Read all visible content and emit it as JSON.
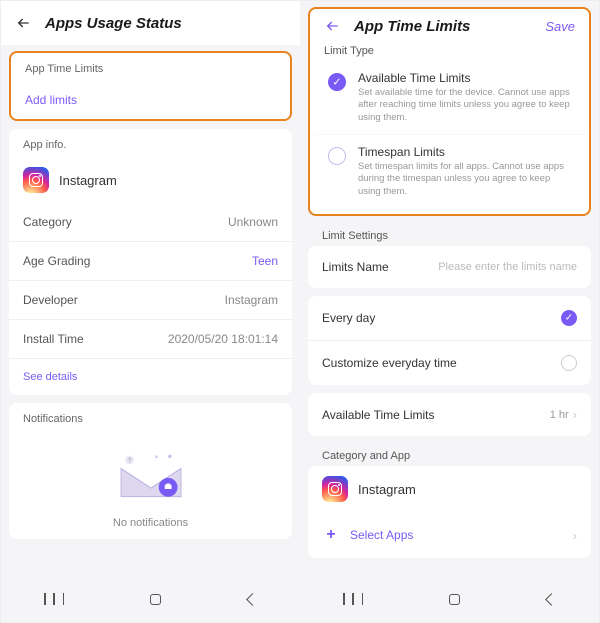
{
  "left": {
    "header": {
      "title": "Apps Usage Status"
    },
    "timeLimitsCard": {
      "heading": "App Time Limits",
      "addLink": "Add limits"
    },
    "appInfo": {
      "heading": "App info.",
      "appName": "Instagram",
      "rows": {
        "categoryLabel": "Category",
        "categoryValue": "Unknown",
        "ageLabel": "Age Grading",
        "ageValue": "Teen",
        "devLabel": "Developer",
        "devValue": "Instagram",
        "installLabel": "Install Time",
        "installValue": "2020/05/20 18:01:14"
      },
      "seeDetails": "See details"
    },
    "notifications": {
      "heading": "Notifications",
      "empty": "No notifications"
    }
  },
  "right": {
    "header": {
      "title": "App Time Limits",
      "save": "Save"
    },
    "limitTypeHeading": "Limit Type",
    "options": {
      "availTitle": "Available Time Limits",
      "availDesc": "Set available time for the device. Cannot use apps after reaching time limits unless you agree to keep using them.",
      "spanTitle": "Timespan Limits",
      "spanDesc": "Set timespan limits for all apps. Cannot use apps during the timespan unless you agree to keep using them."
    },
    "limitSettingsHeading": "Limit Settings",
    "limitsName": {
      "label": "Limits Name",
      "placeholder": "Please enter the limits name"
    },
    "schedule": {
      "every": "Every day",
      "custom": "Customize everyday time"
    },
    "avail": {
      "label": "Available Time Limits",
      "value": "1 hr"
    },
    "categoryHeading": "Category and App",
    "catApp": {
      "appName": "Instagram",
      "select": "Select Apps"
    }
  }
}
